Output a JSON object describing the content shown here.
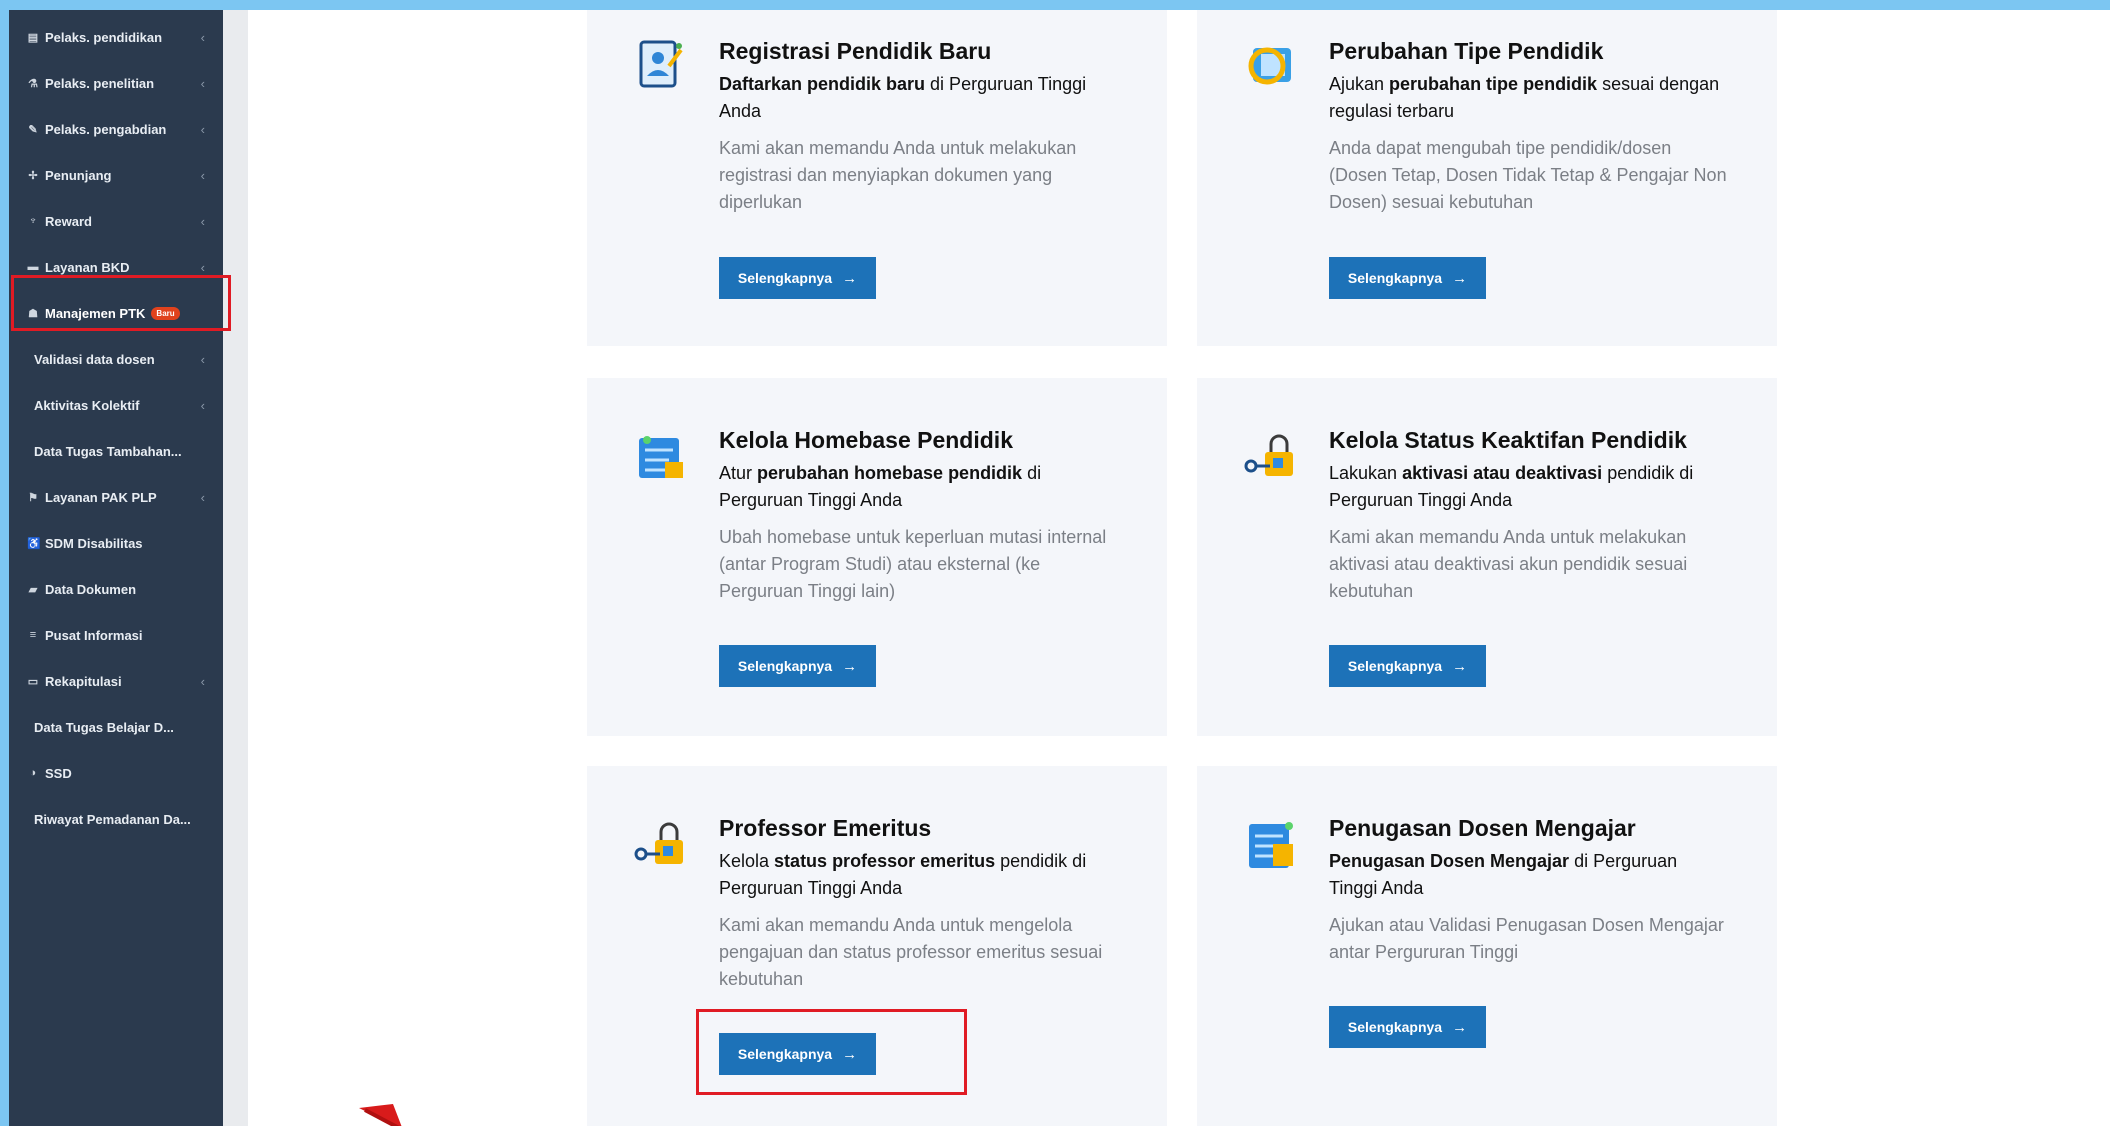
{
  "sidebar": {
    "items": [
      {
        "label": "Pelaks. pendidikan",
        "icon": "book-icon",
        "glyph": "▤",
        "chevron": "‹"
      },
      {
        "label": "Pelaks. penelitian",
        "icon": "flask-icon",
        "glyph": "⚗",
        "chevron": "‹"
      },
      {
        "label": "Pelaks. pengabdian",
        "icon": "link-icon",
        "glyph": "✎",
        "chevron": "‹"
      },
      {
        "label": "Penunjang",
        "icon": "cogs-icon",
        "glyph": "✢",
        "chevron": "‹"
      },
      {
        "label": "Reward",
        "icon": "trophy-icon",
        "glyph": "♆",
        "chevron": "‹"
      },
      {
        "label": "Layanan BKD",
        "icon": "briefcase-icon",
        "glyph": "▬",
        "chevron": "‹"
      },
      {
        "label": "Manajemen PTK",
        "icon": "users-icon",
        "glyph": "☗",
        "badge": "Baru"
      },
      {
        "label": "Validasi data dosen",
        "chevron": "‹"
      },
      {
        "label": "Aktivitas Kolektif",
        "chevron": "‹"
      },
      {
        "label": "Data Tugas Tambahan..."
      },
      {
        "label": "Layanan PAK PLP",
        "icon": "flag-icon",
        "glyph": "⚑",
        "chevron": "‹"
      },
      {
        "label": "SDM Disabilitas",
        "icon": "wheelchair-icon",
        "glyph": "♿"
      },
      {
        "label": "Data Dokumen",
        "icon": "folder-icon",
        "glyph": "▰"
      },
      {
        "label": "Pusat Informasi",
        "icon": "list-icon",
        "glyph": "≡"
      },
      {
        "label": "Rekapitulasi",
        "icon": "table-icon",
        "glyph": "▭",
        "chevron": "‹"
      },
      {
        "label": "Data Tugas Belajar D..."
      },
      {
        "label": "SSD",
        "icon": "contrast-icon",
        "glyph": "◑"
      },
      {
        "label": "Riwayat Pemadanan Da..."
      }
    ]
  },
  "cards": [
    {
      "title": "Registrasi Pendidik Baru",
      "sub": [
        {
          "b": "Daftarkan pendidik baru"
        },
        {
          "t": " di Perguruan Tinggi Anda"
        }
      ],
      "desc": "Kami akan memandu Anda untuk melakukan registrasi dan menyiapkan dokumen yang diperlukan",
      "button": "Selengkapnya",
      "icon": "registration-icon"
    },
    {
      "title": "Perubahan Tipe Pendidik",
      "sub": [
        {
          "t": "Ajukan "
        },
        {
          "b": "perubahan tipe pendidik"
        },
        {
          "t": " sesuai dengan regulasi terbaru"
        }
      ],
      "desc": "Anda dapat mengubah tipe pendidik/dosen (Dosen Tetap, Dosen Tidak Tetap & Pengajar Non Dosen) sesuai kebutuhan",
      "button": "Selengkapnya",
      "icon": "change-type-icon"
    },
    {
      "title": "Kelola Homebase Pendidik",
      "sub": [
        {
          "t": "Atur "
        },
        {
          "b": "perubahan homebase pendidik"
        },
        {
          "t": " di Perguruan Tinggi Anda"
        }
      ],
      "desc": "Ubah homebase untuk keperluan mutasi internal (antar Program Studi) atau eksternal (ke Perguruan Tinggi lain)",
      "button": "Selengkapnya",
      "icon": "homebase-icon"
    },
    {
      "title": "Kelola Status Keaktifan Pendidik",
      "sub": [
        {
          "t": "Lakukan "
        },
        {
          "b": "aktivasi atau deaktivasi"
        },
        {
          "t": " pendidik di Perguruan Tinggi Anda"
        }
      ],
      "desc": "Kami akan memandu Anda untuk melakukan aktivasi atau deaktivasi akun pendidik sesuai kebutuhan",
      "button": "Selengkapnya",
      "icon": "key-lock-icon"
    },
    {
      "title": "Professor Emeritus",
      "sub": [
        {
          "t": "Kelola "
        },
        {
          "b": "status professor emeritus"
        },
        {
          "t": " pendidik di Perguruan Tinggi Anda"
        }
      ],
      "desc": "Kami akan memandu Anda untuk mengelola pengajuan dan status professor emeritus sesuai kebutuhan",
      "button": "Selengkapnya",
      "icon": "key-lock-icon"
    },
    {
      "title": "Penugasan Dosen Mengajar",
      "sub": [
        {
          "b": "Penugasan Dosen Mengajar"
        },
        {
          "t": " di Perguruan Tinggi Anda"
        }
      ],
      "desc": "Ajukan atau Validasi Penugasan Dosen Mengajar antar Pergururan Tinggi",
      "button": "Selengkapnya",
      "icon": "assignment-icon"
    }
  ],
  "button_arrow": "→",
  "colors": {
    "sidebar": "#2b3a4e",
    "button": "#1d72b8",
    "highlight": "#e01b24",
    "badge": "#e0421d"
  }
}
